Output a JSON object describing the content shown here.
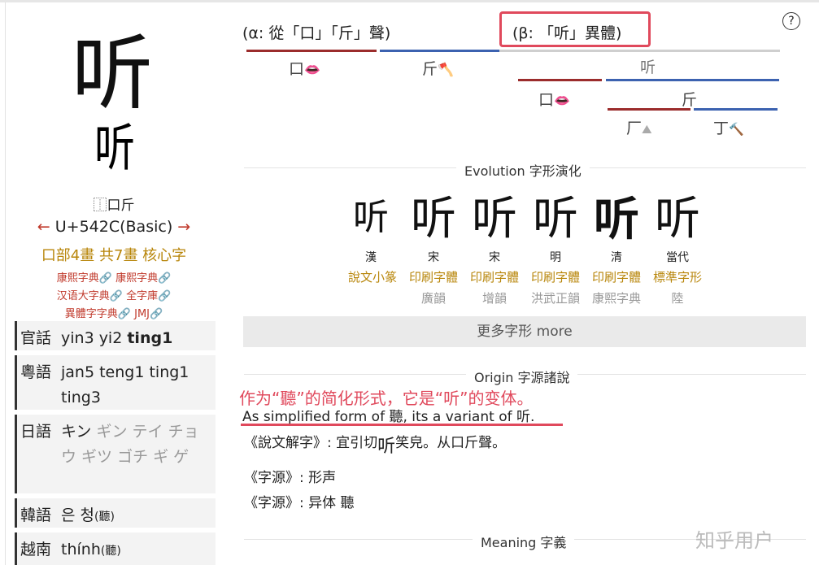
{
  "character": {
    "main": "听",
    "seal": "听",
    "components": "⿰口斤",
    "unicode": "U+542C(Basic)",
    "prev_arrow": "←",
    "next_arrow": "→",
    "radical_info": "口部4畫 共7畫 核心字",
    "dicts": [
      "康熙字典",
      "康熙字典",
      "汉语大字典",
      "全字庫",
      "異體字字典",
      "JMJ"
    ]
  },
  "pronunciations": [
    {
      "lang": "官話",
      "value_plain": "yin3 yi2 ",
      "value_bold": "ting1"
    },
    {
      "lang": "粵語",
      "value": "jan5 teng1 ting1 ting3"
    },
    {
      "lang": "日語",
      "value_main": "キン",
      "value_grey": "ギン テイ チョウ ギツ ゴチ ギ ゲ"
    },
    {
      "lang": "韓語",
      "value": "은 청",
      "value_small": "(聽)"
    },
    {
      "lang": "越南",
      "value": "thính",
      "value_small": "(聽)"
    }
  ],
  "structure": {
    "alpha": "(α: 從「口」「斤」聲)",
    "beta": "(β: 「听」異體)",
    "alpha_parts": [
      "口",
      "斤"
    ],
    "beta_top": "听",
    "beta_parts": [
      "口",
      "斤"
    ],
    "beta_sub": [
      "厂",
      "丁"
    ]
  },
  "help_icon": "?",
  "evolution": {
    "title": "Evolution 字形演化",
    "items": [
      {
        "glyph": "听",
        "era": "漢",
        "source": "說文小篆",
        "book": ""
      },
      {
        "glyph": "听",
        "era": "宋",
        "source": "印刷字體",
        "book": "廣韻"
      },
      {
        "glyph": "听",
        "era": "宋",
        "source": "印刷字體",
        "book": "增韻"
      },
      {
        "glyph": "听",
        "era": "明",
        "source": "印刷字體",
        "book": "洪武正韻"
      },
      {
        "glyph": "听",
        "era": "清",
        "source": "印刷字體",
        "book": "康熙字典"
      },
      {
        "glyph": "听",
        "era": "當代",
        "source": "標準字形",
        "book": "陸"
      }
    ],
    "more": "更多字形 more"
  },
  "origin": {
    "title": "Origin 字源諸說",
    "annotation": "作为“聽”的简化形式，它是“听”的变体。",
    "english": "As simplified form of 聽, its a variant of 听.",
    "shuowen": "《說文解字》:  宜引切",
    "shuowen_glyph": "听",
    "shuowen_tail": "笑皃。从口斤聲。",
    "ziyuan1": "《字源》: 形声",
    "ziyuan2": "《字源》: 异体 聽"
  },
  "meaning": {
    "title": "Meaning 字義"
  },
  "watermark": "知乎用户",
  "colors": {
    "red": "#9b2c2c",
    "blue": "#3c62b0",
    "gold": "#b8860b",
    "highlight": "#e0495c"
  }
}
